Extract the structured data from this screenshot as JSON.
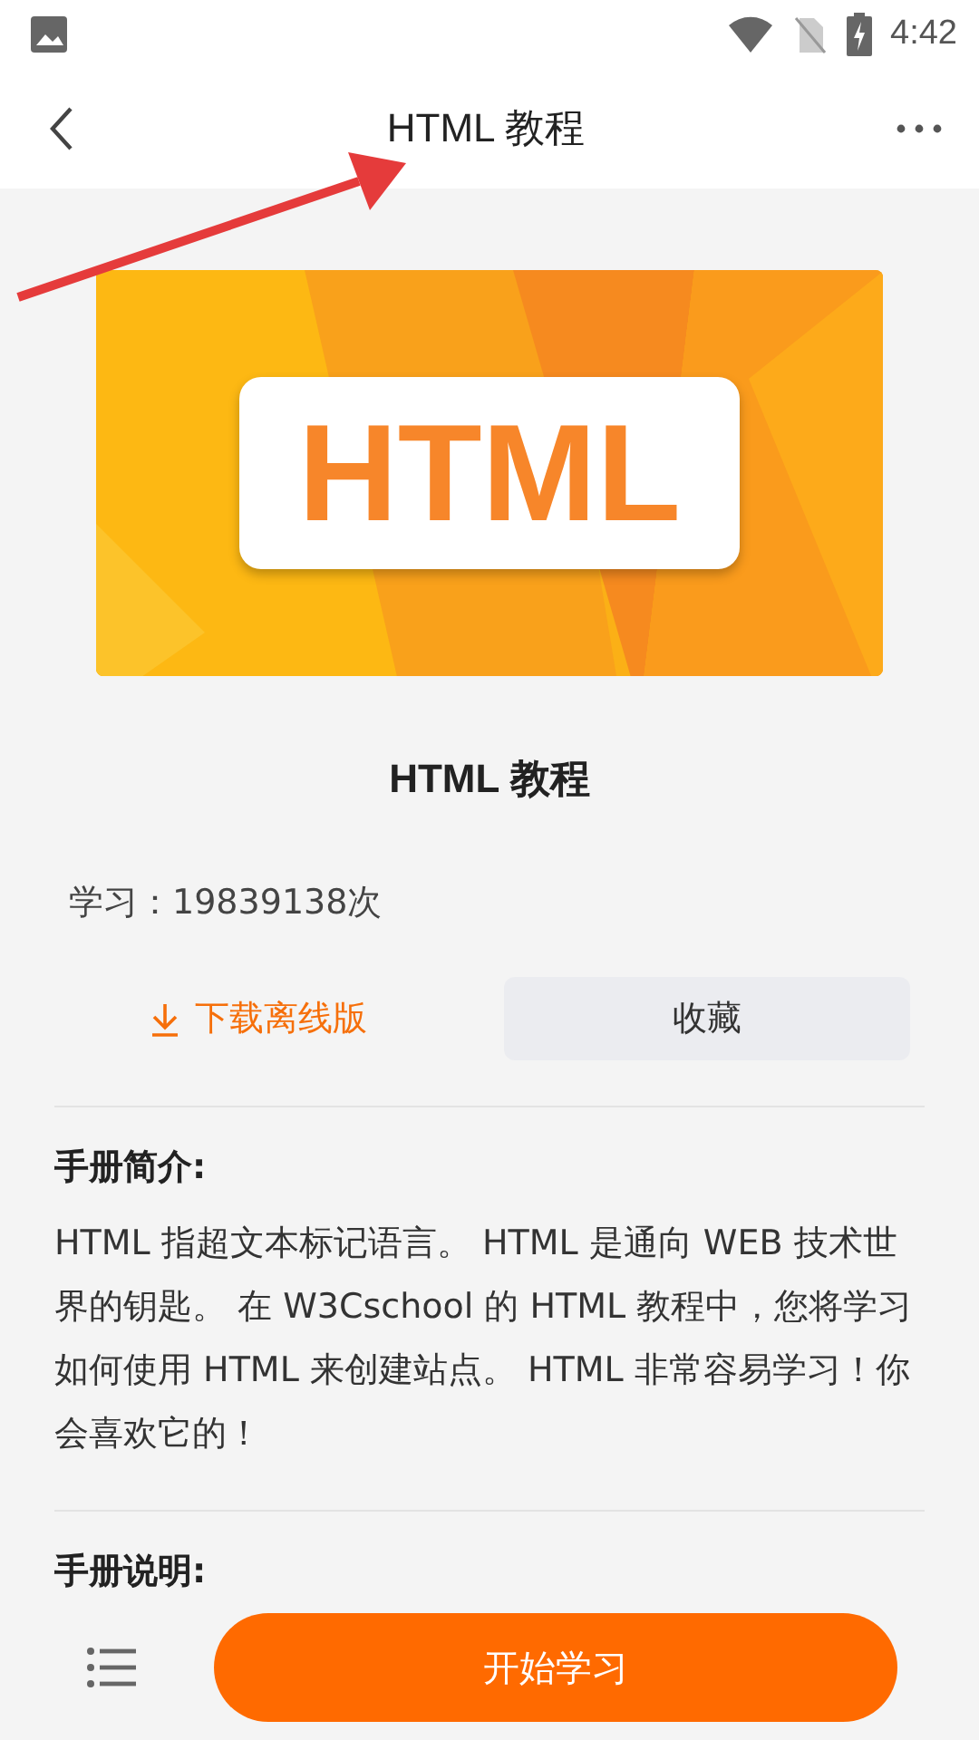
{
  "status_bar": {
    "time": "4:42"
  },
  "header": {
    "title": "HTML 教程"
  },
  "annotation": {
    "kind": "arrow"
  },
  "banner": {
    "label": "HTML"
  },
  "course": {
    "title": "HTML 教程",
    "study_count": "学习：19839138次"
  },
  "actions": [
    {
      "kind": "download",
      "label": "下载离线版"
    },
    {
      "kind": "favorite",
      "label": "收藏"
    }
  ],
  "sections": [
    {
      "heading": "手册简介:",
      "body": "HTML 指超文本标记语言。 HTML 是通向 WEB 技术世界的钥匙。 在 W3Cschool 的 HTML 教程中，您将学习如何使用 HTML 来创建站点。 HTML 非常容易学习！你会喜欢它的！"
    },
    {
      "heading": "手册说明:"
    }
  ],
  "bottom_bar": {
    "start_button": "开始学习"
  }
}
